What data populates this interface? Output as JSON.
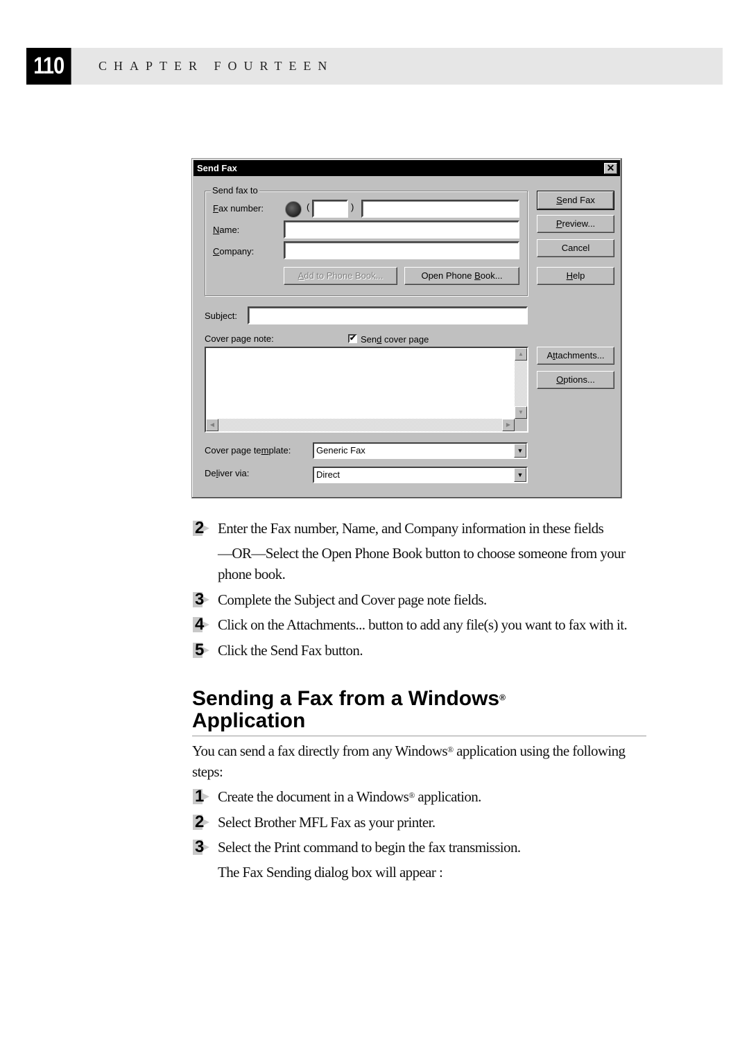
{
  "header": {
    "page_number": "110",
    "chapter": "CHAPTER FOURTEEN"
  },
  "dialog": {
    "title": "Send Fax",
    "close_glyph": "✕",
    "group": {
      "legend": "Send fax to",
      "fax_number_label": {
        "u": "F",
        "rest": "ax number:"
      },
      "name_label": {
        "u": "N",
        "rest": "ame:"
      },
      "company_label": {
        "u": "C",
        "rest": "ompany:"
      },
      "open_paren": "(",
      "close_paren": ")",
      "area_code_value": "",
      "fax_number_value": "",
      "name_value": "",
      "company_value": "",
      "add_phonebook_button": {
        "u": "A",
        "rest": "dd to Phone Book..."
      },
      "open_phonebook_button": {
        "pre": "Open Phone ",
        "u": "B",
        "rest": "ook..."
      }
    },
    "buttons": {
      "send_fax": {
        "u": "S",
        "rest": "end Fax"
      },
      "preview": {
        "u": "P",
        "rest": "review..."
      },
      "cancel": "Cancel",
      "help": {
        "u": "H",
        "rest": "elp"
      },
      "attachments": {
        "pre": "A",
        "u": "t",
        "rest": "tachments..."
      },
      "options": {
        "u": "O",
        "rest": "ptions..."
      }
    },
    "subject_label": "Subject:",
    "subject_value": "",
    "cover_note_label": "Cover page note:",
    "send_cover_checkbox": {
      "checked": true,
      "pre": "Sen",
      "u": "d",
      "rest": " cover page"
    },
    "cover_note_value": "",
    "template_label": {
      "pre": "Cover page te",
      "u": "m",
      "rest": "plate:"
    },
    "template_value": "Generic Fax",
    "deliver_label": {
      "pre": "De",
      "u": "l",
      "rest": "iver via:"
    },
    "deliver_value": "Direct"
  },
  "steps_a": [
    {
      "num": "2",
      "text": "Enter the Fax number, Name, and Company information in these fields",
      "cont": [
        "—OR—Select the Open Phone Book button to choose someone from your",
        "phone book."
      ]
    },
    {
      "num": "3",
      "text": "Complete the Subject and Cover page note fields."
    },
    {
      "num": "4",
      "text": "Click on the Attachments... button to add any file(s) you want to fax with it."
    },
    {
      "num": "5",
      "text": "Click the Send Fax button."
    }
  ],
  "section": {
    "title_line1": "Sending a Fax from a Windows",
    "title_line2": "Application",
    "reg": "®",
    "intro_pre": "You can send a fax directly from any Windows",
    "intro_post": " application using the following",
    "intro_line2": "steps:"
  },
  "steps_b": [
    {
      "num": "1",
      "pre": "Create the document in a Windows",
      "post": " application."
    },
    {
      "num": "2",
      "text": "Select Brother MFL Fax as your printer."
    },
    {
      "num": "3",
      "text": "Select the Print command to begin the fax transmission.",
      "cont": "The Fax Sending dialog box will appear :"
    }
  ]
}
